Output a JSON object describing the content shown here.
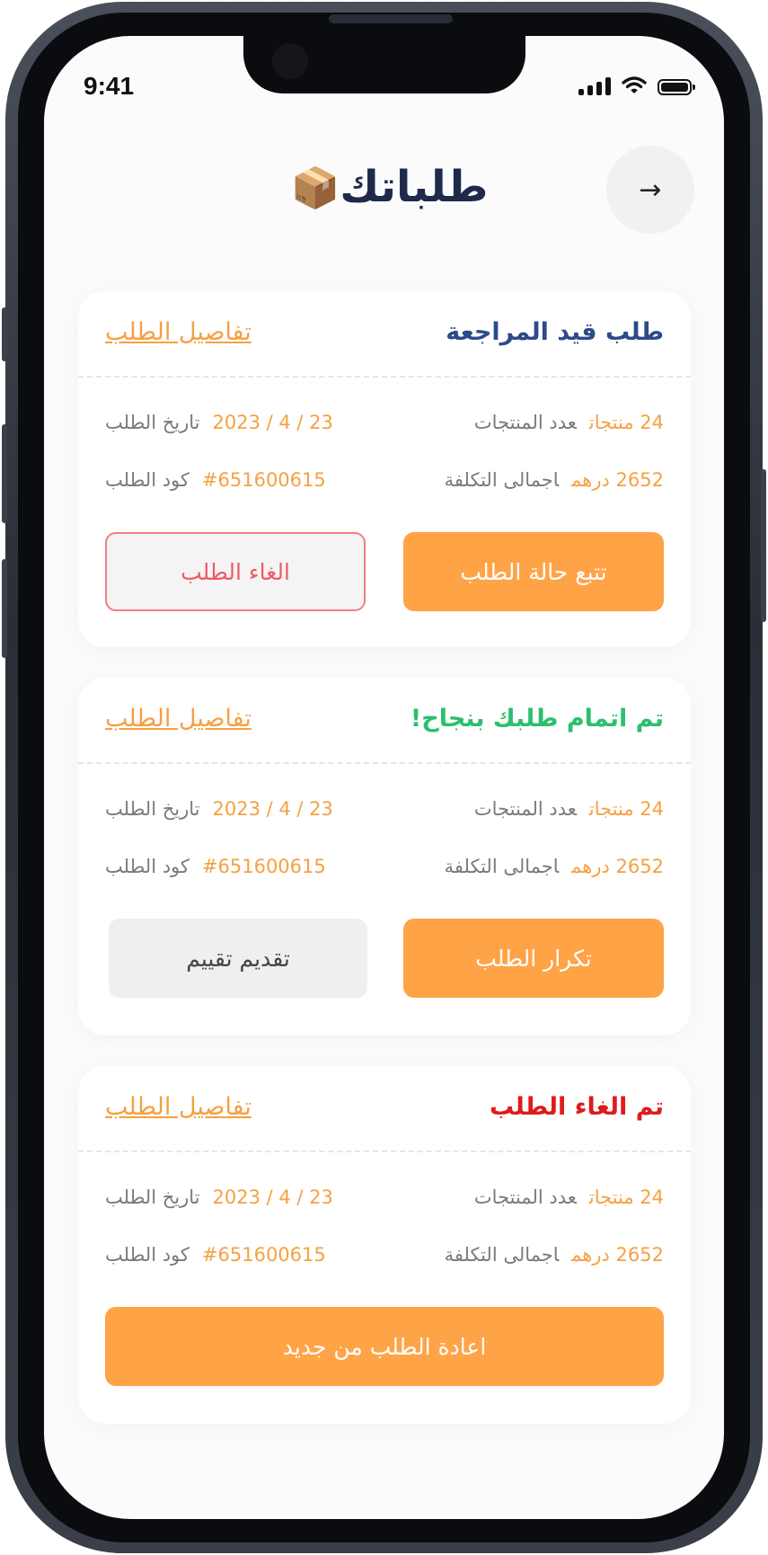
{
  "status_bar": {
    "time": "9:41"
  },
  "header": {
    "title": "طلباتك",
    "title_icon": "📦",
    "back_arrow": "→"
  },
  "labels": {
    "details_link": "تفاصيل الطلب",
    "products_count_label": "عدد المنتجات",
    "total_cost_label": "اجمالى التكلفة",
    "order_date_label": "تاريخ الطلب",
    "order_code_label": "كود الطلب"
  },
  "orders": [
    {
      "status": "طلب قيد المراجعة",
      "status_color": "#2d4a8a",
      "products_count": "24 منتجات",
      "total_cost": "2652 درهم",
      "order_date": "2023 / 4 / 23",
      "order_code": "#651600615",
      "primary_button": "تتبع حالة الطلب",
      "secondary_button": "الغاء الطلب"
    },
    {
      "status": "تم اتمام طلبك بنجاح!",
      "status_color": "#2bbf6e",
      "products_count": "24 منتجات",
      "total_cost": "2652 درهم",
      "order_date": "2023 / 4 / 23",
      "order_code": "#651600615",
      "primary_button": "تكرار الطلب",
      "secondary_button": "تقديم تقييم"
    },
    {
      "status": "تم الغاء الطلب",
      "status_color": "#e01b1b",
      "products_count": "24 منتجات",
      "total_cost": "2652 درهم",
      "order_date": "2023 / 4 / 23",
      "order_code": "#651600615",
      "primary_button": "اعادة الطلب من جديد"
    }
  ],
  "colors": {
    "accent": "#ffa347",
    "accent_text": "#f5a142",
    "title": "#1f2a4a",
    "cancel_border": "#f47c86"
  }
}
